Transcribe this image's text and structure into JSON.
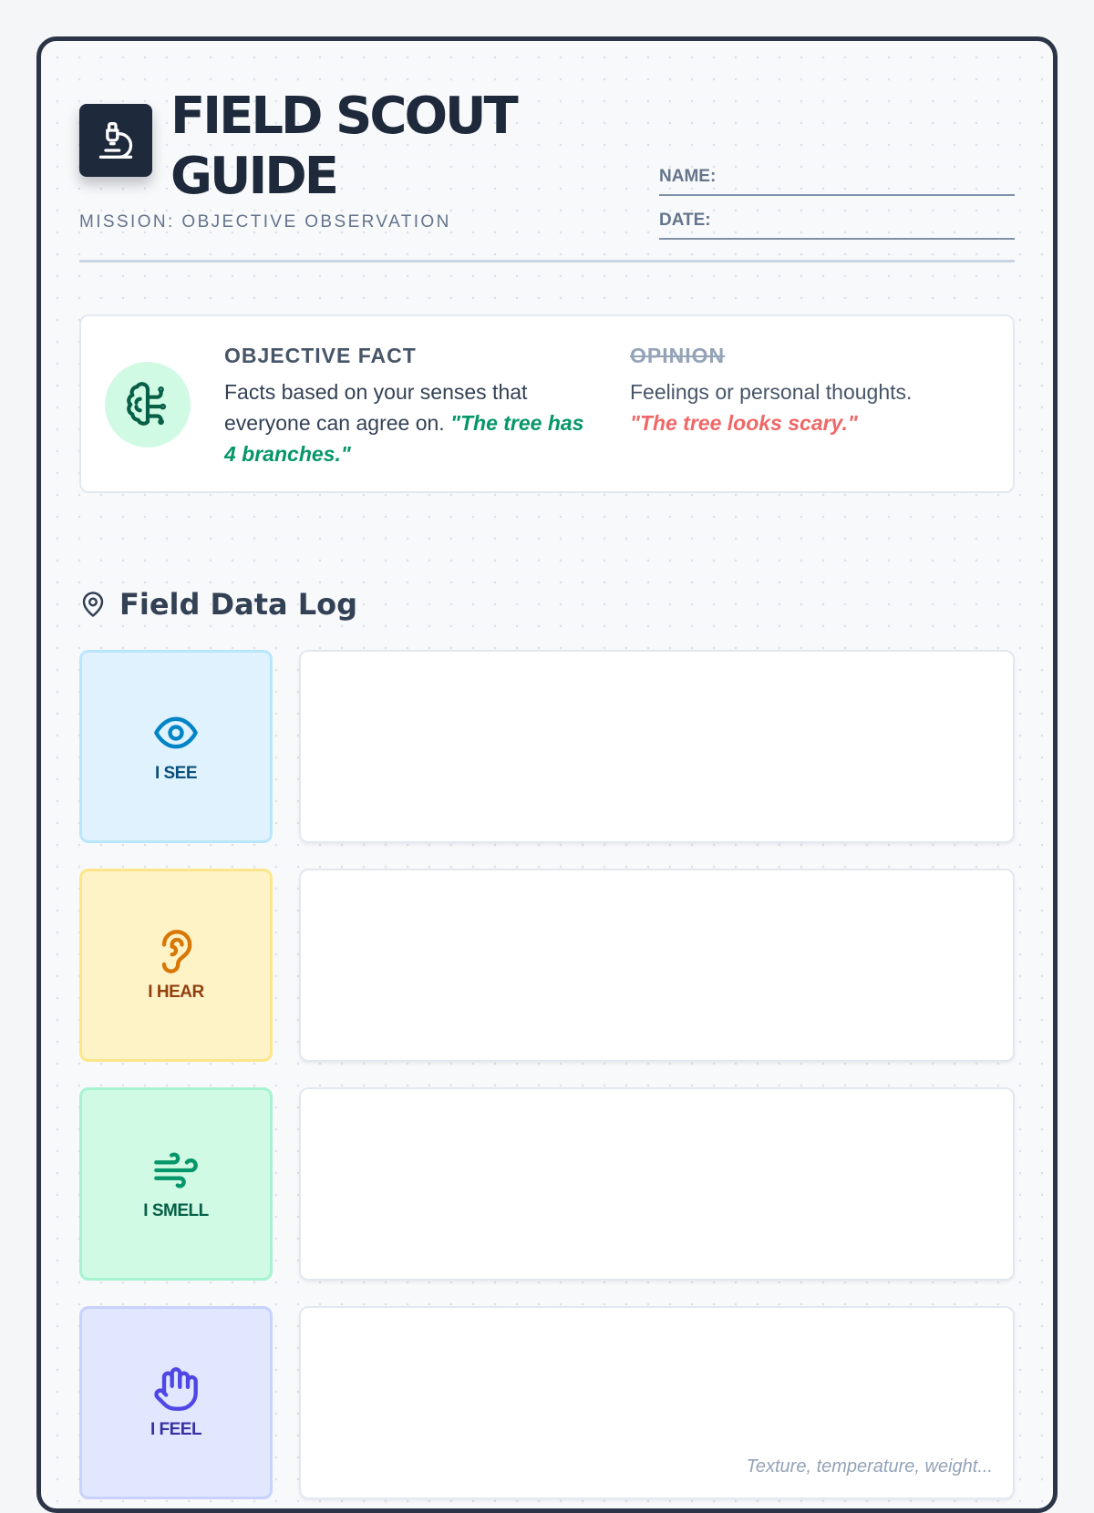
{
  "header": {
    "title": "FIELD SCOUT GUIDE",
    "mission": "MISSION: OBJECTIVE OBSERVATION",
    "name_label": "NAME:",
    "date_label": "DATE:"
  },
  "comparison": {
    "fact_heading": "OBJECTIVE FACT",
    "fact_text": "Facts based on your senses that everyone can agree on.",
    "fact_example": "\"The tree has 4 branches.\"",
    "opinion_heading": "OPINION",
    "opinion_text": "Feelings or personal thoughts.",
    "opinion_example": "\"The tree looks scary.\""
  },
  "log": {
    "title": "Field Data Log",
    "rows": [
      {
        "label": "I SEE",
        "icon": "eye-icon",
        "hint": ""
      },
      {
        "label": "I HEAR",
        "icon": "ear-icon",
        "hint": ""
      },
      {
        "label": "I SMELL",
        "icon": "wind-icon",
        "hint": ""
      },
      {
        "label": "I FEEL",
        "icon": "hand-icon",
        "hint": "Texture, temperature, weight..."
      }
    ]
  },
  "colors": {
    "see": "#0284c7",
    "hear": "#d97706",
    "smell": "#059669",
    "feel": "#4f46e5",
    "fact_green": "#059669",
    "opinion_red": "#f06767",
    "dark": "#1e293b"
  }
}
